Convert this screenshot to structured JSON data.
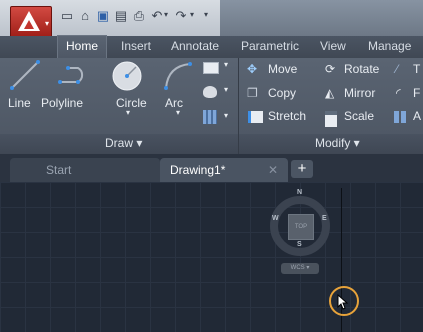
{
  "ribbon": {
    "tabs": [
      "Home",
      "Insert",
      "Annotate",
      "Parametric",
      "View",
      "Manage"
    ],
    "draw": {
      "tools": [
        "Line",
        "Polyline",
        "Circle",
        "Arc"
      ],
      "panel_label": "Draw ▾"
    },
    "modify": {
      "tools": [
        "Move",
        "Rotate",
        "Copy",
        "Mirror",
        "Stretch",
        "Scale"
      ],
      "panel_label": "Modify ▾",
      "truncated": [
        "T",
        "F",
        "A"
      ]
    }
  },
  "file_tabs": {
    "start": "Start",
    "drawing": "Drawing1*",
    "close": "✕",
    "new_tab": "+"
  },
  "viewcube": {
    "north": "N",
    "south": "S",
    "east": "E",
    "west": "W",
    "face": "TOP",
    "wcs": "WCS ▾"
  },
  "colors": {
    "accent_red": "#c3352e",
    "cursor_highlight": "#e8a33a",
    "canvas_bg": "#212936"
  }
}
